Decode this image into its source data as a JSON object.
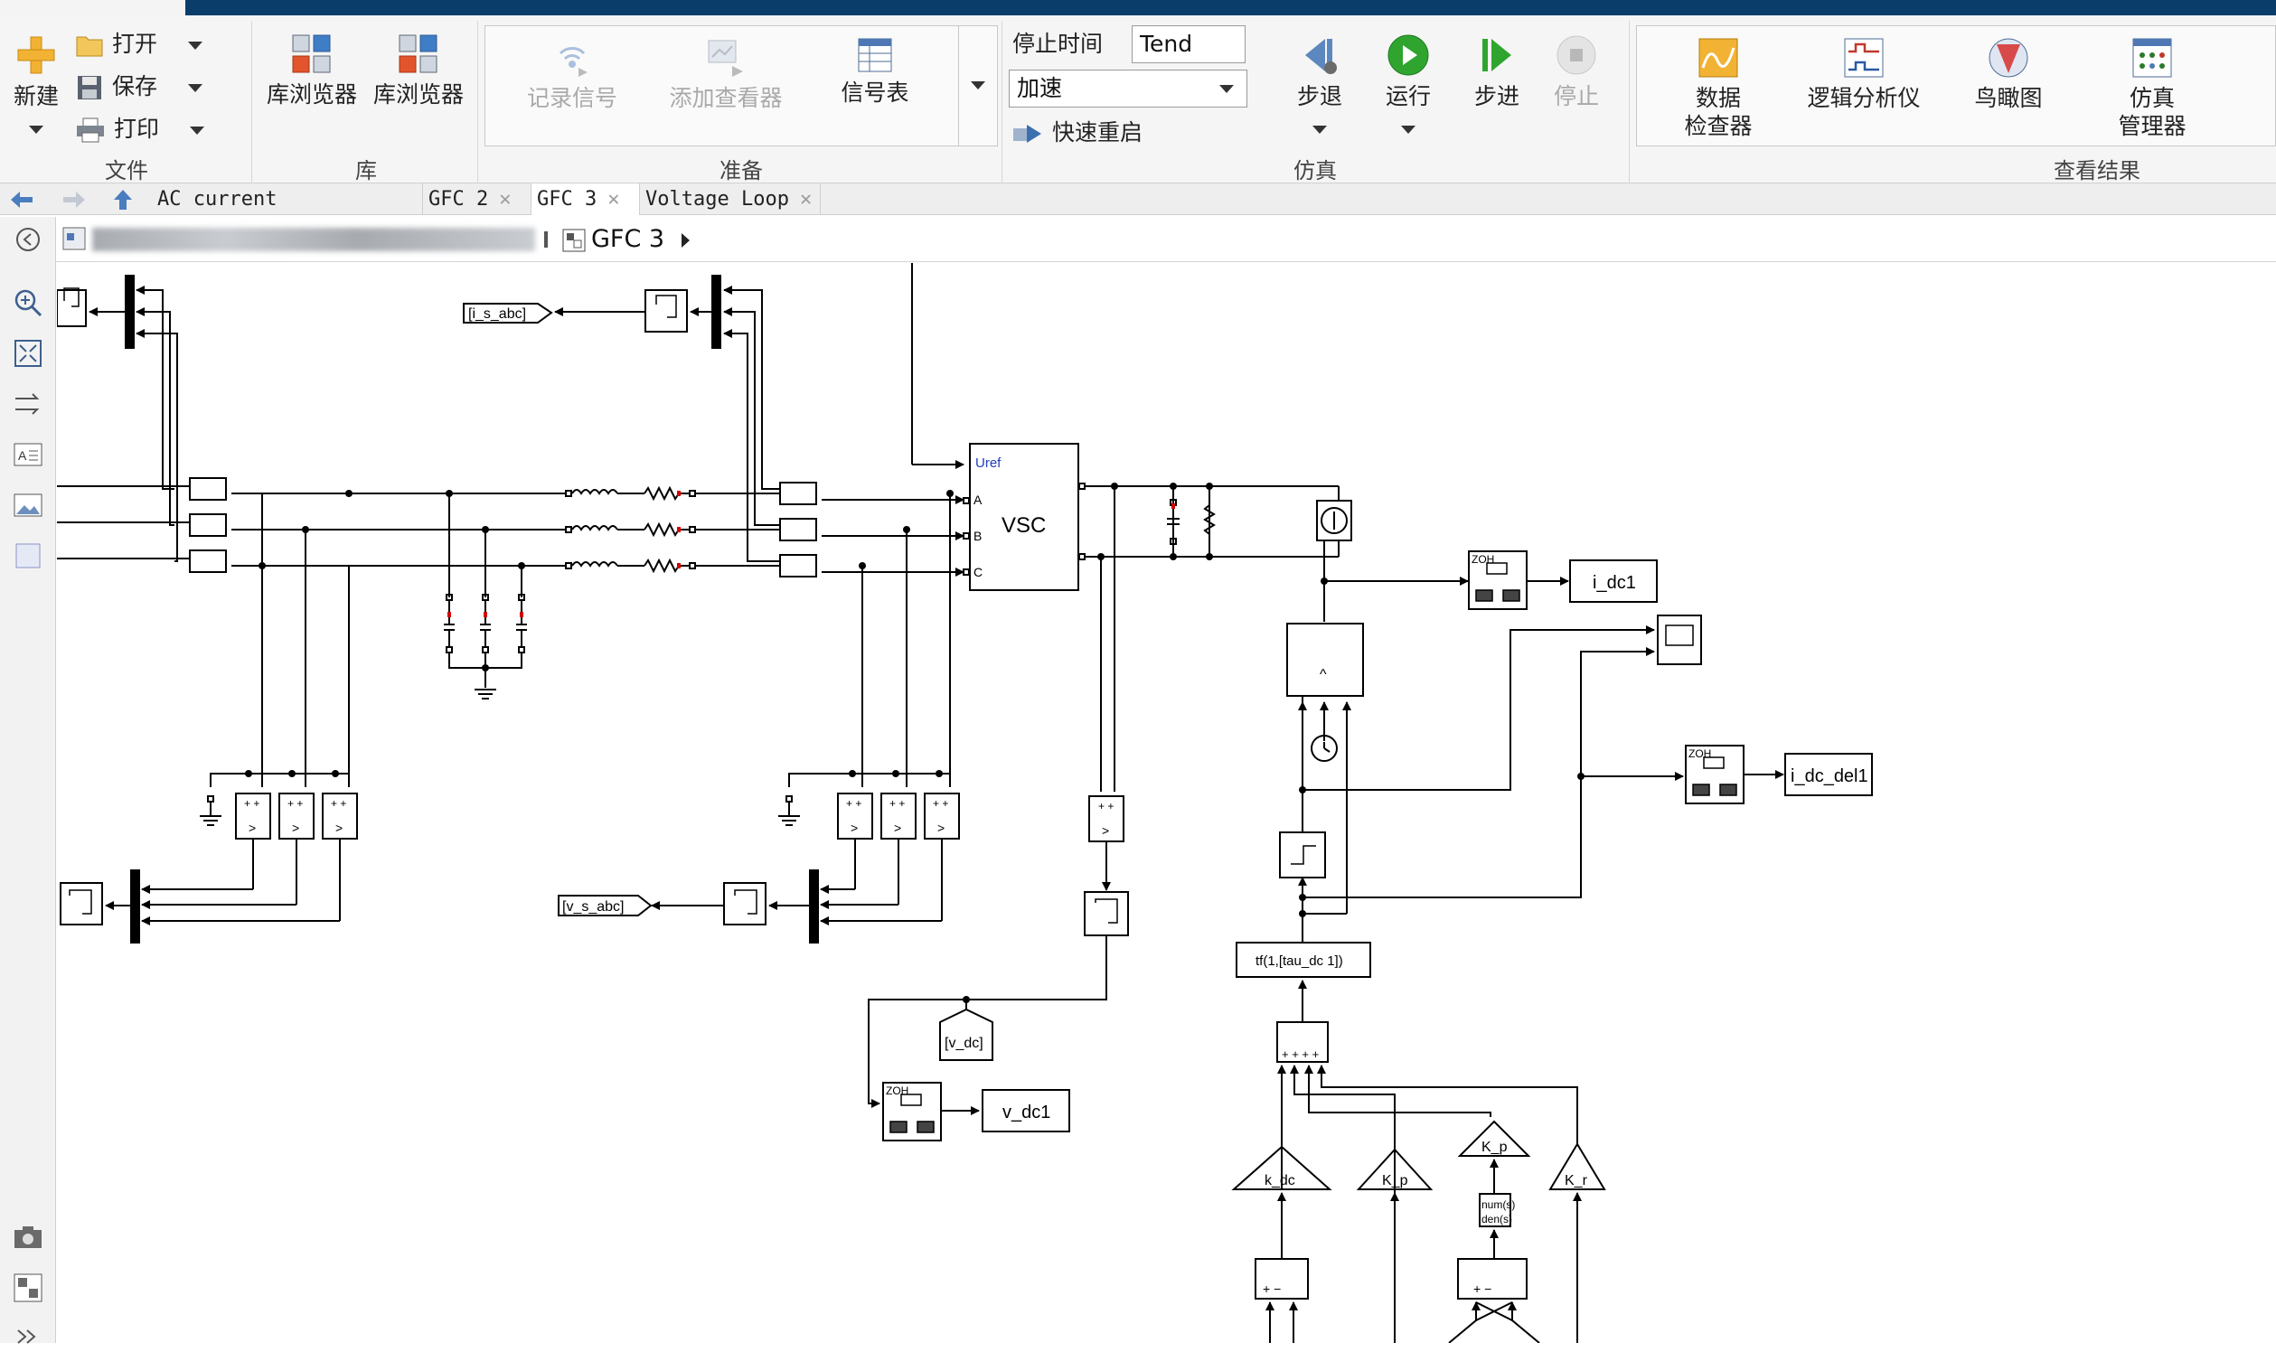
{
  "ribbon": {
    "file": {
      "new_label": "新建",
      "open_label": "打开",
      "save_label": "保存",
      "print_label": "打印",
      "group_label": "文件"
    },
    "library": {
      "browser1_label": "库浏览器",
      "browser2_label": "库浏览器",
      "group_label": "库"
    },
    "prepare": {
      "record_signal_label": "记录信号",
      "add_viewer_label": "添加查看器",
      "signal_table_label": "信号表",
      "group_label": "准备"
    },
    "simulation": {
      "stop_time_label": "停止时间",
      "stop_time_value": "Tend",
      "mode_value": "加速",
      "fast_restart_label": "快速重启",
      "step_back_label": "步退",
      "run_label": "运行",
      "step_forward_label": "步进",
      "stop_label": "停止",
      "group_label": "仿真"
    },
    "results": {
      "data_inspector_label_1": "数据",
      "data_inspector_label_2": "检查器",
      "logic_analyzer_label": "逻辑分析仪",
      "birds_eye_label": "鸟瞰图",
      "sim_manager_label_1": "仿真",
      "sim_manager_label_2": "管理器",
      "group_label": "查看结果"
    }
  },
  "tabs": [
    {
      "label": "AC current limitation",
      "active": false
    },
    {
      "label": "GFC 2",
      "active": false
    },
    {
      "label": "GFC 3",
      "active": true
    },
    {
      "label": "Voltage Loop",
      "active": false
    }
  ],
  "breadcrumb": {
    "current": "GFC 3"
  },
  "diagram": {
    "goto_i_s_abc": "[i_s_abc]",
    "goto_v_s_abc": "[v_s_abc]",
    "goto_v_dc": "[v_dc]",
    "vsc_label": "VSC",
    "vsc_uref": "Uref",
    "vsc_port_a": "A",
    "vsc_port_b": "B",
    "vsc_port_c": "C",
    "out_i_dc1": "i_dc1",
    "out_i_dc_del1": "i_dc_del1",
    "out_v_dc1": "v_dc1",
    "zoh": "ZOH",
    "tf_label": "tf(1,[tau_dc 1])",
    "gain_k_dc": "k_dc",
    "gain_k_p1": "K_p",
    "gain_k_p2": "K_p",
    "gain_k_r": "K_r",
    "num_label": "num(s)",
    "den_label": "den(s)",
    "sum4_signs": "+ + + +",
    "sum_signs": "+   −",
    "comp_signs": "+ +",
    "comp_op": ">",
    "switch_op": "^"
  },
  "colors": {
    "title_bar": "#0b3d6b",
    "run_green": "#2fa52f",
    "port_red": "#d60000",
    "uref_blue": "#1f3fb8"
  }
}
